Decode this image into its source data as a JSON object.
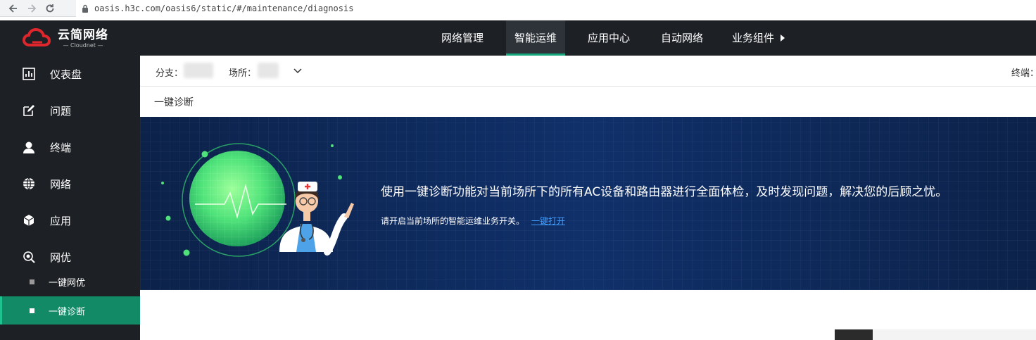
{
  "browser": {
    "url": "oasis.h3c.com/oasis6/static/#/maintenance/diagnosis"
  },
  "app": {
    "logo_main": "云简网络",
    "logo_sub": "— Cloudnet —"
  },
  "topnav": {
    "items": [
      {
        "label": "网络管理"
      },
      {
        "label": "智能运维"
      },
      {
        "label": "应用中心"
      },
      {
        "label": "自动网络"
      },
      {
        "label": "业务组件"
      }
    ],
    "active": "智能运维",
    "accent": "#17a77c"
  },
  "sidebar": {
    "items": [
      {
        "label": "仪表盘",
        "icon": "dashboard-icon"
      },
      {
        "label": "问题",
        "icon": "edit-icon"
      },
      {
        "label": "终端",
        "icon": "user-icon"
      },
      {
        "label": "网络",
        "icon": "globe-icon"
      },
      {
        "label": "应用",
        "icon": "cube-icon"
      },
      {
        "label": "网优",
        "icon": "tuning-icon"
      }
    ],
    "sub_items": [
      {
        "label": "一键网优"
      },
      {
        "label": "一键诊断"
      }
    ],
    "active_sub": "一键诊断"
  },
  "filter": {
    "branch_label": "分支：",
    "site_label": "场所：",
    "terminal_label": "终端："
  },
  "page": {
    "title": "一键诊断"
  },
  "banner": {
    "main_text": "使用一键诊断功能对当前场所下的所有AC设备和路由器进行全面体检，及时发现问题，解决您的后顾之忧。",
    "sub_text": "请开启当前场所的智能运维业务开关。",
    "link_text": "一键打开"
  }
}
